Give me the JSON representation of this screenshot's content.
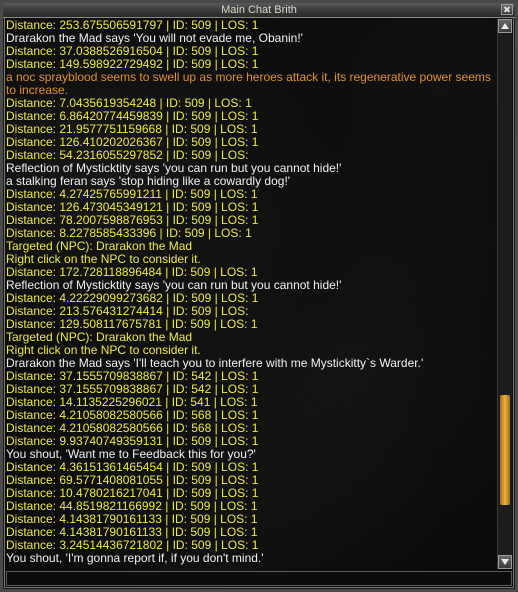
{
  "window": {
    "title": "Main Chat Brith"
  },
  "chat_input": {
    "value": ""
  },
  "scrollbar": {
    "position_fraction": 0.88
  },
  "colors": {
    "system": "#ecec3c",
    "say": "#f2f2f2",
    "emote": "#e09030"
  },
  "chat": {
    "lines": [
      {
        "type": "sys",
        "text": "Distance: 253.675506591797 | ID: 509 | LOS: 1"
      },
      {
        "type": "say",
        "text": "Drarakon the Mad says 'You will not evade me, Obanin!'"
      },
      {
        "type": "sys",
        "text": "Distance: 37.0388526916504 | ID: 509 | LOS: 1"
      },
      {
        "type": "sys",
        "text": "Distance: 149.598922729492 | ID: 509 | LOS: 1"
      },
      {
        "type": "emote",
        "text": "a noc sprayblood seems to swell up as more heroes attack it, its regenerative power seems to increase."
      },
      {
        "type": "sys",
        "text": "Distance: 7.0435619354248 | ID: 509 | LOS: 1"
      },
      {
        "type": "sys",
        "text": "Distance: 6.86420774459839 | ID: 509 | LOS: 1"
      },
      {
        "type": "sys",
        "text": "Distance: 21.9577751159668 | ID: 509 | LOS: 1"
      },
      {
        "type": "sys",
        "text": "Distance: 126.410202026367 | ID: 509 | LOS: 1"
      },
      {
        "type": "sys",
        "text": "Distance: 54.2316055297852 | ID: 509 | LOS:"
      },
      {
        "type": "say",
        "text": "Reflection of Mysticktity says 'you can run but you cannot hide!'"
      },
      {
        "type": "say",
        "text": "a stalking feran says 'stop hiding like a cowardly dog!'"
      },
      {
        "type": "sys",
        "text": "Distance: 4.27425765991211 | ID: 509 | LOS: 1"
      },
      {
        "type": "sys",
        "text": "Distance: 126.473045349121 | ID: 509 | LOS: 1"
      },
      {
        "type": "sys",
        "text": "Distance: 78.2007598876953 | ID: 509 | LOS: 1"
      },
      {
        "type": "sys",
        "text": "Distance: 8.2278585433396 | ID: 509 | LOS: 1"
      },
      {
        "type": "sys",
        "text": "Targeted (NPC): Drarakon the Mad"
      },
      {
        "type": "sys",
        "text": "Right click on the NPC to consider it."
      },
      {
        "type": "sys",
        "text": "Distance: 172.728118896484 | ID: 509 | LOS: 1"
      },
      {
        "type": "say",
        "text": "Reflection of Mysticktity says 'you can run but you cannot hide!'"
      },
      {
        "type": "sys",
        "text": "Distance: 4.22229099273682 | ID: 509 | LOS: 1"
      },
      {
        "type": "sys",
        "text": "Distance: 213.576431274414 | ID: 509 | LOS:"
      },
      {
        "type": "sys",
        "text": "Distance: 129.508117675781 | ID: 509 | LOS: 1"
      },
      {
        "type": "sys",
        "text": "Targeted (NPC): Drarakon the Mad"
      },
      {
        "type": "sys",
        "text": "Right click on the NPC to consider it."
      },
      {
        "type": "say",
        "text": "Drarakon the Mad says 'I'll teach you to interfere with me Mystickitty`s Warder.'"
      },
      {
        "type": "sys",
        "text": "Distance: 37.1555709838867 | ID: 542 | LOS: 1"
      },
      {
        "type": "sys",
        "text": "Distance: 37.1555709838867 | ID: 542 | LOS: 1"
      },
      {
        "type": "sys",
        "text": "Distance: 14.1135225296021 | ID: 541 | LOS: 1"
      },
      {
        "type": "sys",
        "text": "Distance: 4.21058082580566 | ID: 568 | LOS: 1"
      },
      {
        "type": "sys",
        "text": "Distance: 4.21058082580566 | ID: 568 | LOS: 1"
      },
      {
        "type": "sys",
        "text": "Distance: 9.93740749359131 | ID: 509 | LOS: 1"
      },
      {
        "type": "say",
        "text": "You shout, 'Want me to Feedback this for you?'"
      },
      {
        "type": "sys",
        "text": "Distance: 4.36151361465454 | ID: 509 | LOS: 1"
      },
      {
        "type": "sys",
        "text": "Distance: 69.5771408081055 | ID: 509 | LOS: 1"
      },
      {
        "type": "sys",
        "text": "Distance: 10.4780216217041 | ID: 509 | LOS: 1"
      },
      {
        "type": "sys",
        "text": "Distance: 44.8519821166992 | ID: 509 | LOS: 1"
      },
      {
        "type": "sys",
        "text": "Distance: 4.14381790161133 | ID: 509 | LOS: 1"
      },
      {
        "type": "sys",
        "text": "Distance: 4.14381790161133 | ID: 509 | LOS: 1"
      },
      {
        "type": "sys",
        "text": "Distance: 3.24514436721802 | ID: 509 | LOS: 1"
      },
      {
        "type": "say",
        "text": "You shout, 'I'm gonna report if, if you don't mind.'"
      }
    ]
  }
}
